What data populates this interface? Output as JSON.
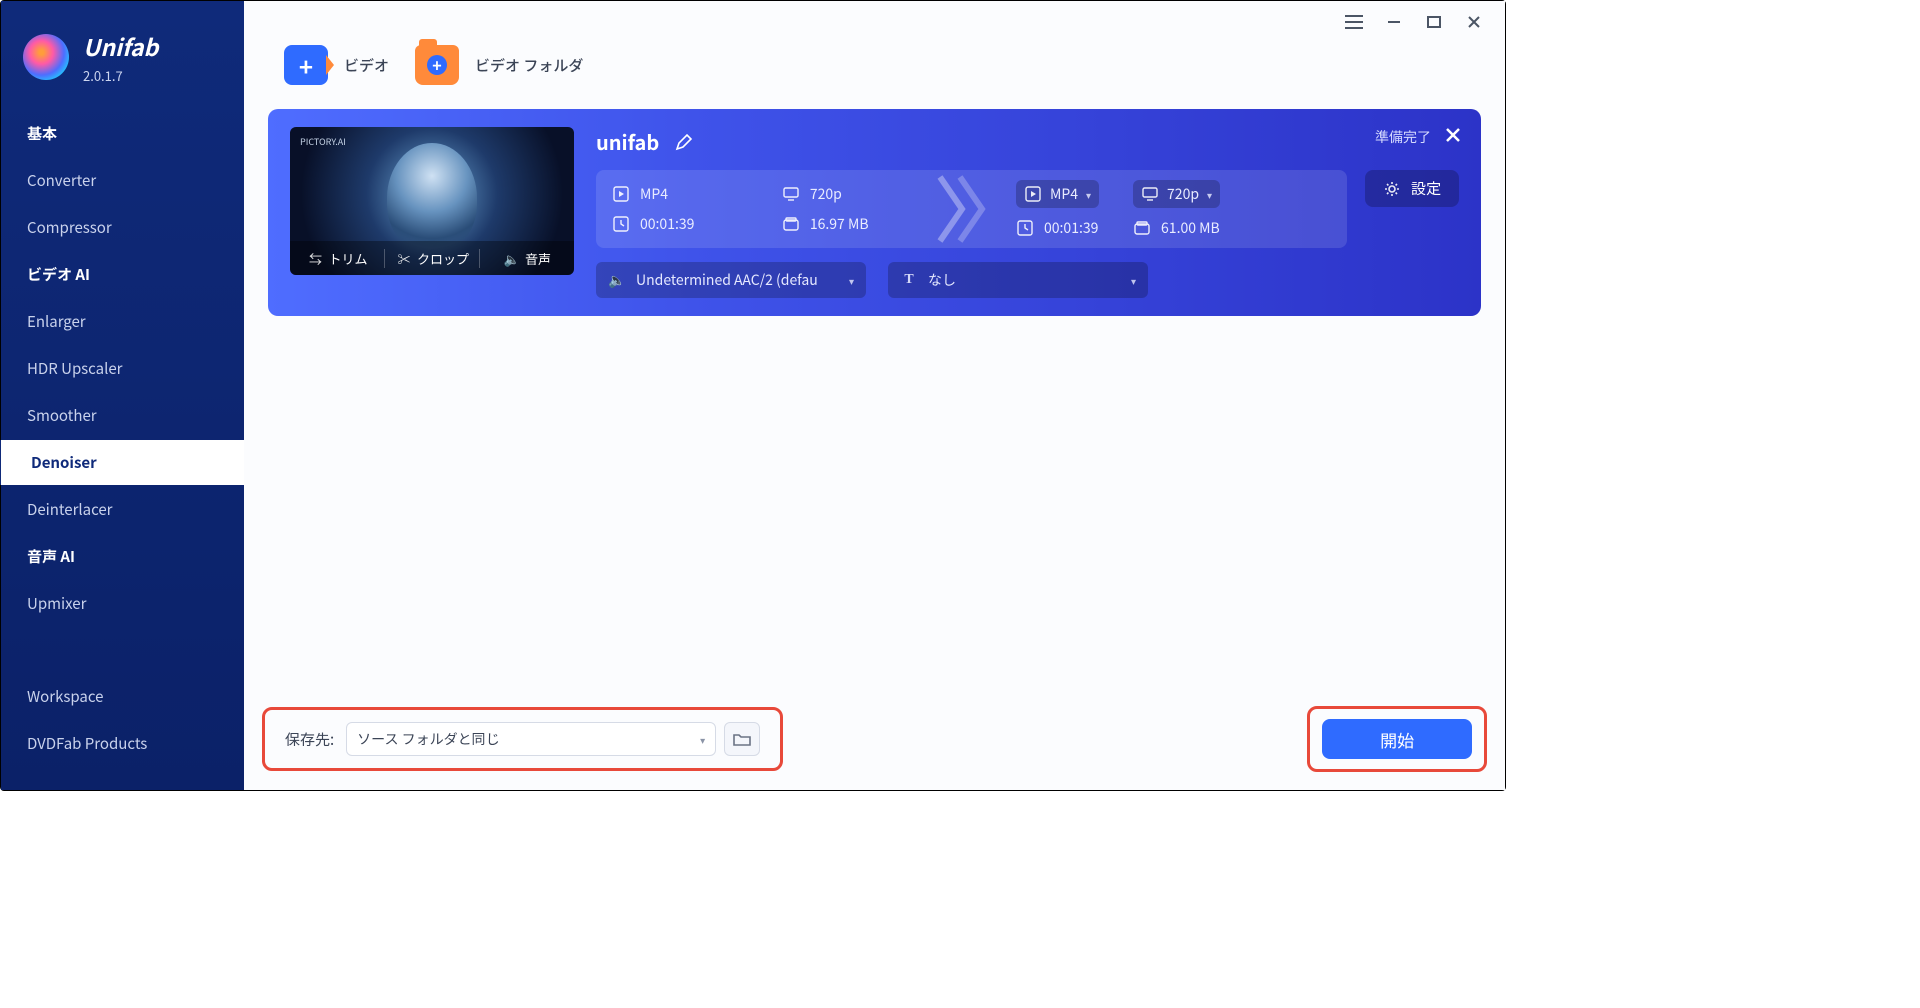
{
  "brand": {
    "name": "Unifab",
    "version": "2.0.1.7"
  },
  "sidebar": {
    "sections": {
      "basic": "基本",
      "video_ai": "ビデオ AI",
      "audio_ai": "音声 AI"
    },
    "items": {
      "converter": "Converter",
      "compressor": "Compressor",
      "enlarger": "Enlarger",
      "hdr": "HDR Upscaler",
      "smoother": "Smoother",
      "denoiser": "Denoiser",
      "deinterlacer": "Deinterlacer",
      "upmixer": "Upmixer",
      "workspace": "Workspace",
      "dvdfab": "DVDFab Products"
    }
  },
  "toolbar": {
    "add_video": "ビデオ",
    "add_folder": "ビデオ フォルダ"
  },
  "task": {
    "status": "準備完了",
    "filename": "unifab",
    "thumb_tag": "PICTORY.AI",
    "tools": {
      "trim": "トリム",
      "crop": "クロップ",
      "audio": "音声"
    },
    "source": {
      "format": "MP4",
      "resolution": "720p",
      "duration": "00:01:39",
      "size": "16.97 MB"
    },
    "output": {
      "format": "MP4",
      "resolution": "720p",
      "duration": "00:01:39",
      "size": "61.00 MB"
    },
    "settings_label": "設定",
    "audio_track": "Undetermined AAC/2 (defau",
    "subtitle": "なし"
  },
  "footer": {
    "save_label": "保存先:",
    "save_value": "ソース フォルダと同じ",
    "start_label": "開始"
  }
}
